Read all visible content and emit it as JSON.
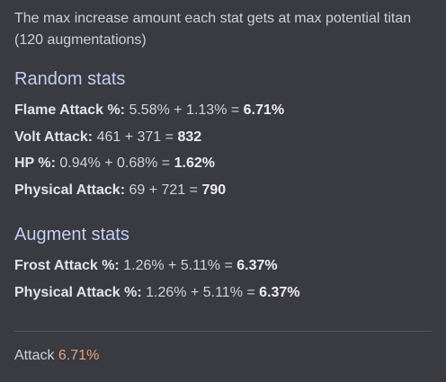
{
  "intro_text": "The max increase amount each stat gets at max potential titan (120 augmentations)",
  "random_stats": {
    "title": "Random stats",
    "rows": [
      {
        "label": "Flame Attack %:",
        "formula": "5.58% + 1.13% =",
        "total": "6.71%"
      },
      {
        "label": "Volt Attack:",
        "formula": "461 + 371 =",
        "total": "832"
      },
      {
        "label": "HP %:",
        "formula": "0.94% + 0.68% =",
        "total": "1.62%"
      },
      {
        "label": "Physical Attack:",
        "formula": "69 + 721 =",
        "total": "790"
      }
    ]
  },
  "augment_stats": {
    "title": "Augment stats",
    "rows": [
      {
        "label": "Frost Attack %:",
        "formula": "1.26% + 5.11% =",
        "total": "6.37%"
      },
      {
        "label": "Physical Attack %:",
        "formula": "1.26% + 5.11% =",
        "total": "6.37%"
      }
    ]
  },
  "footer": {
    "label": "Attack",
    "value": "6.71%",
    "value_color": "#e9a17a"
  },
  "colors": {
    "background": "#3a3a41",
    "section_title": "#c3cef2"
  }
}
